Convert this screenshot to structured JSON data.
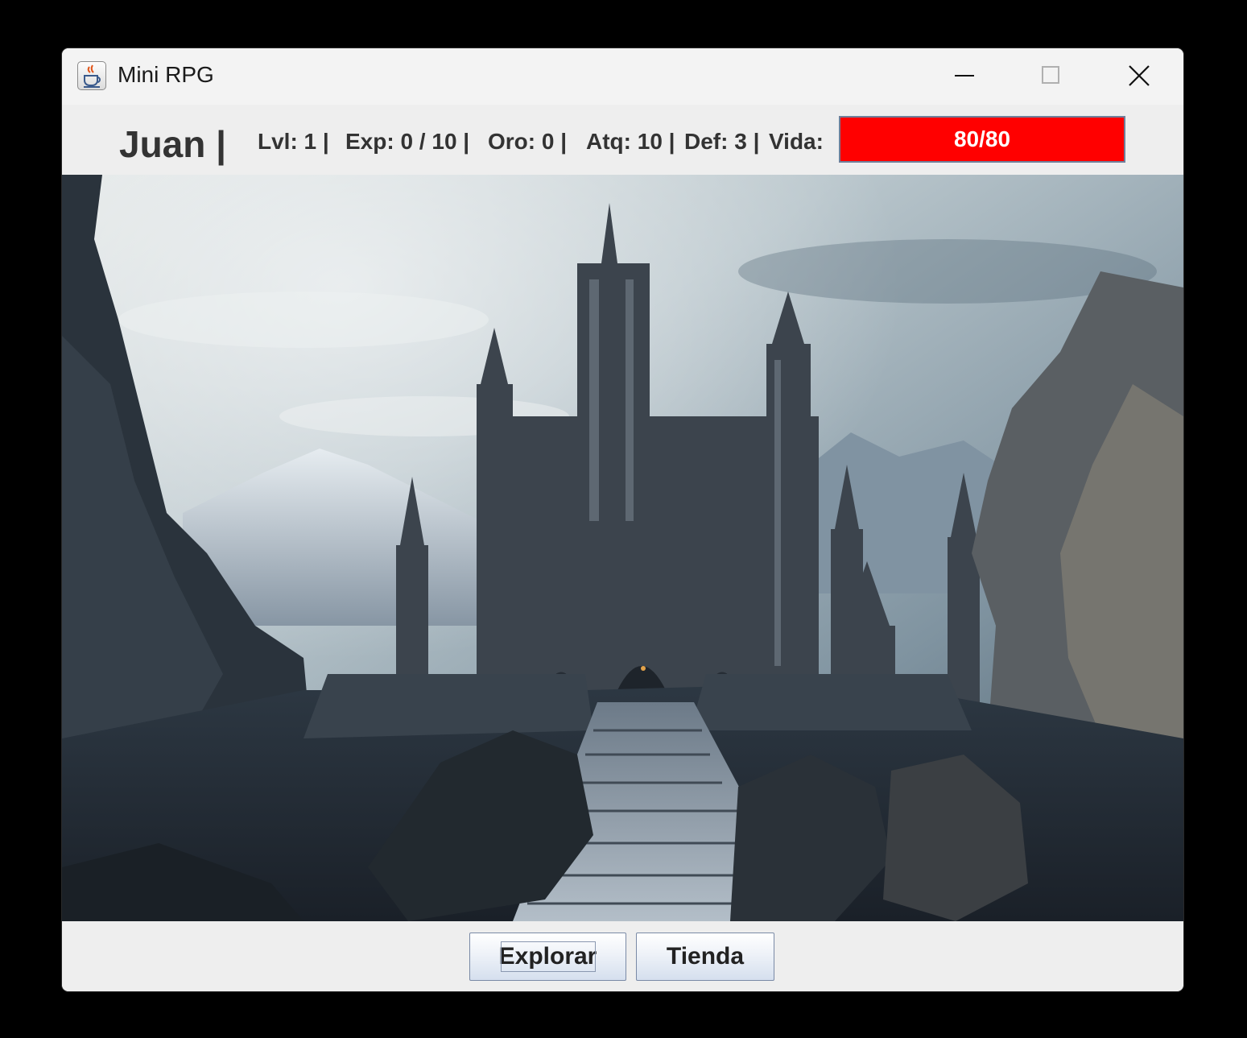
{
  "window": {
    "title": "Mini RPG",
    "icons": {
      "app": "java-cup-icon",
      "minimize": "minimize-icon",
      "maximize": "maximize-icon",
      "close": "close-icon"
    }
  },
  "player": {
    "name": "Juan |",
    "level": "Lvl: 1 |",
    "exp": "Exp: 0 / 10 |",
    "gold": "Oro: 0 |",
    "attack": "Atq: 10 |",
    "defense": "Def: 3 |",
    "life_label": "Vida:",
    "health": {
      "text": "80/80",
      "current": 80,
      "max": 80,
      "fraction": 1.0,
      "color": "#ff0000"
    }
  },
  "scene": {
    "icon": "castle-landscape-image"
  },
  "actions": {
    "explore_label": "Explorar",
    "shop_label": "Tienda"
  }
}
